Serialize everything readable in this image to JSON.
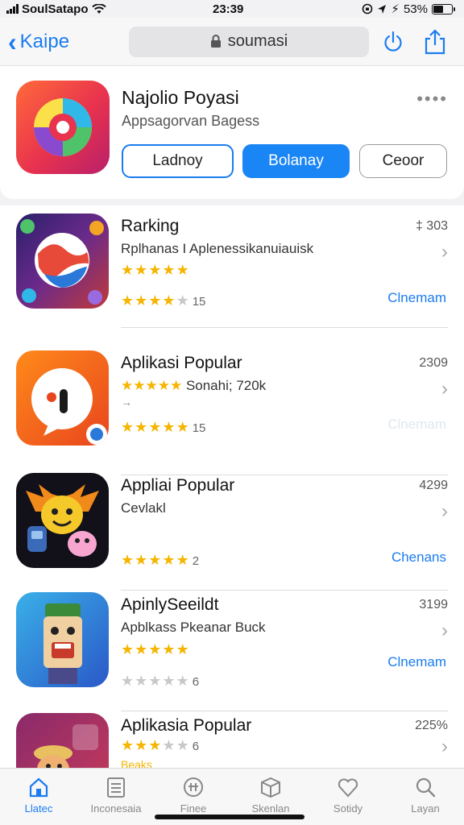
{
  "status_bar": {
    "carrier": "SoulSatapo",
    "time": "23:39",
    "battery": "53%",
    "battery_level": 0.53
  },
  "nav": {
    "back_label": "Kaipe",
    "url": "soumasi"
  },
  "hero": {
    "title": "Najolio Poyasi",
    "subtitle": "Appsagorvan Bagess",
    "more": "••••",
    "buttons": [
      "Ladnoy",
      "Bolanay",
      "Ceoor"
    ]
  },
  "apps": [
    {
      "title": "Rarking",
      "subtitle": "Rplhanas I Aplenessikanuiauisk",
      "number": "‡ 303",
      "rating1": 4.5,
      "rating2": 4,
      "count": "15",
      "link": "Clnemam",
      "link_faded": false
    },
    {
      "title": "Aplikasi Popular",
      "subtitle": "Sonahi; 720k",
      "subtitle_stars": "★★★★★",
      "extra": "→",
      "number": "2309",
      "rating1": null,
      "rating2": 4.5,
      "count": "15",
      "link": "Clnemam",
      "link_faded": true
    },
    {
      "title": "Appliai Popular",
      "subtitle": "Cevlakl",
      "number": "4299",
      "rating1": null,
      "rating2": 4.5,
      "count": "2",
      "link": "Chenans",
      "link_faded": false
    },
    {
      "title": "ApinlySeeildt",
      "subtitle": "Apblkass Pkeanar Buck",
      "number": "3199",
      "rating1": 4.5,
      "rating2": 0,
      "count": "6",
      "link": "Clnemam",
      "link_faded": false
    },
    {
      "title": "Aplikasia Popular",
      "subtitle": "",
      "number": "225%",
      "rating1": 3,
      "rating2": null,
      "count": "6",
      "link": "",
      "link_faded": false,
      "footer": "Beaks"
    }
  ],
  "tabs": [
    {
      "label": "Llatec",
      "icon": "home-icon",
      "active": true
    },
    {
      "label": "Inconesaia",
      "icon": "list-icon",
      "active": false
    },
    {
      "label": "Finee",
      "icon": "compass-icon",
      "active": false
    },
    {
      "label": "Skenlan",
      "icon": "box-icon",
      "active": false
    },
    {
      "label": "Sotidy",
      "icon": "heart-icon",
      "active": false
    },
    {
      "label": "Layan",
      "icon": "search-icon",
      "active": false
    }
  ],
  "colors": {
    "accent": "#1a7cf0",
    "star": "#f5b500",
    "hero_gradient_start": "#ff6a3a",
    "hero_gradient_end": "#b8206a"
  }
}
